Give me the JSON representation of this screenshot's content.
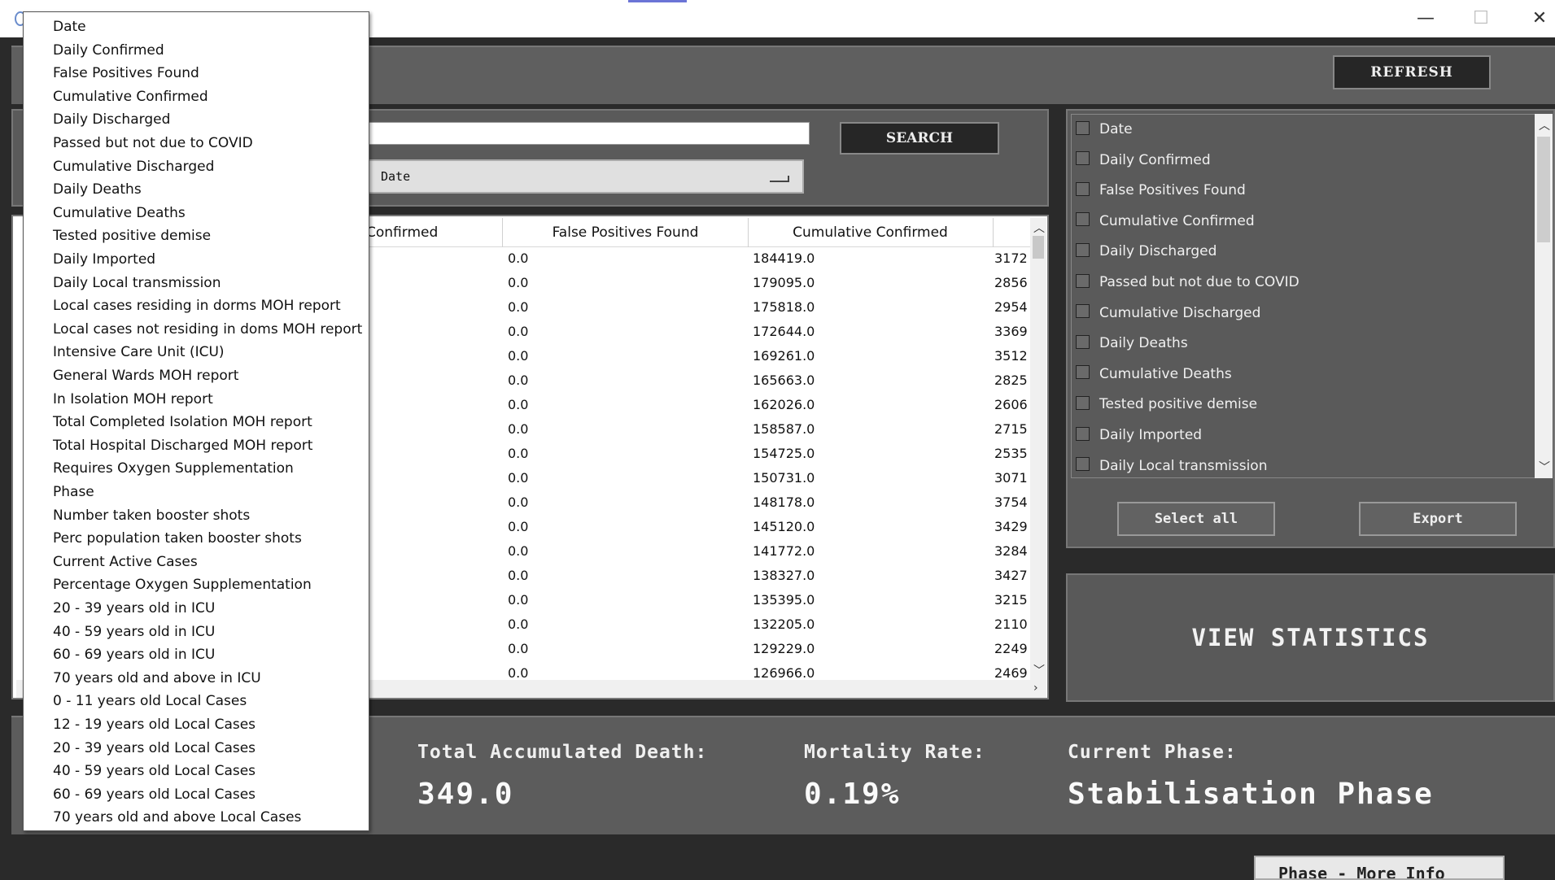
{
  "window": {
    "minimize_glyph": "—",
    "maximize_glyph": "☐",
    "close_glyph": "✕"
  },
  "header": {
    "refresh_label": "REFRESH"
  },
  "search": {
    "value": "",
    "button_label": "SEARCH",
    "selected_column": "Date"
  },
  "table": {
    "columns": [
      "Confirmed",
      "False Positives Found",
      "Cumulative Confirmed"
    ],
    "rows": [
      {
        "fp": "0.0",
        "cum": "184419.0",
        "next": "3172"
      },
      {
        "fp": "0.0",
        "cum": "179095.0",
        "next": "2856"
      },
      {
        "fp": "0.0",
        "cum": "175818.0",
        "next": "2954"
      },
      {
        "fp": "0.0",
        "cum": "172644.0",
        "next": "3369"
      },
      {
        "fp": "0.0",
        "cum": "169261.0",
        "next": "3512"
      },
      {
        "fp": "0.0",
        "cum": "165663.0",
        "next": "2825"
      },
      {
        "fp": "0.0",
        "cum": "162026.0",
        "next": "2606"
      },
      {
        "fp": "0.0",
        "cum": "158587.0",
        "next": "2715"
      },
      {
        "fp": "0.0",
        "cum": "154725.0",
        "next": "2535"
      },
      {
        "fp": "0.0",
        "cum": "150731.0",
        "next": "3071"
      },
      {
        "fp": "0.0",
        "cum": "148178.0",
        "next": "3754"
      },
      {
        "fp": "0.0",
        "cum": "145120.0",
        "next": "3429"
      },
      {
        "fp": "0.0",
        "cum": "141772.0",
        "next": "3284"
      },
      {
        "fp": "0.0",
        "cum": "138327.0",
        "next": "3427"
      },
      {
        "fp": "0.0",
        "cum": "135395.0",
        "next": "3215"
      },
      {
        "fp": "0.0",
        "cum": "132205.0",
        "next": "2110"
      },
      {
        "fp": "0.0",
        "cum": "129229.0",
        "next": "2249"
      },
      {
        "fp": "0.0",
        "cum": "126966.0",
        "next": "2469"
      }
    ]
  },
  "checklist": {
    "items": [
      "Date",
      "Daily Confirmed",
      "False Positives Found",
      "Cumulative Confirmed",
      "Daily Discharged",
      "Passed but not due to COVID",
      "Cumulative Discharged",
      "Daily Deaths",
      "Cumulative Deaths",
      "Tested positive demise",
      "Daily Imported",
      "Daily Local transmission"
    ],
    "select_all_label": "Select all",
    "export_label": "Export"
  },
  "view_stats_label": "VIEW STATISTICS",
  "stats": {
    "death_label": "Total Accumulated Death:",
    "death_value": "349.0",
    "mortality_label": "Mortality Rate:",
    "mortality_value": "0.19%",
    "phase_label": "Current Phase:",
    "phase_value": "Stabilisation Phase",
    "phase_more_label": "Phase - More Info"
  },
  "dropdown": {
    "options": [
      "Date",
      "Daily Confirmed",
      "False Positives Found",
      "Cumulative Confirmed",
      "Daily Discharged",
      "Passed but not due to COVID",
      "Cumulative Discharged",
      "Daily Deaths",
      "Cumulative Deaths",
      "Tested positive demise",
      "Daily Imported",
      "Daily Local transmission",
      "Local cases residing in dorms MOH report",
      "Local cases not residing in doms MOH report",
      "Intensive Care Unit (ICU)",
      "General Wards MOH report",
      "In Isolation MOH report",
      "Total Completed Isolation MOH report",
      "Total Hospital Discharged MOH report",
      "Requires Oxygen Supplementation",
      "Phase",
      "Number taken booster shots",
      "Perc population taken booster shots",
      "Current Active Cases",
      "Percentage Oxygen Supplementation",
      "20 - 39 years old in ICU",
      "40 - 59 years old in ICU",
      "60 - 69 years old in ICU",
      "70 years old and above in ICU",
      "0 - 11 years old Local Cases",
      "12 - 19 years old Local Cases",
      "20 - 39 years old Local Cases",
      "40 - 59 years old Local Cases",
      "60 - 69 years old Local Cases",
      "70 years old and above Local Cases"
    ]
  }
}
